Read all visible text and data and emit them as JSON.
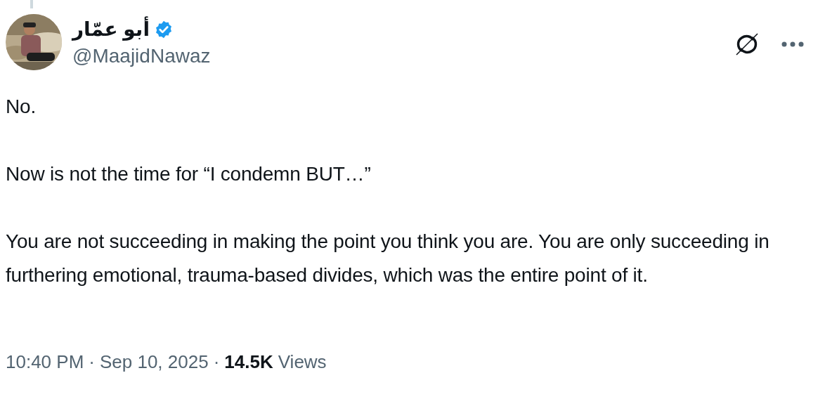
{
  "author": {
    "name": "أبو عمّار",
    "verified": true,
    "handle": "@MaajidNawaz"
  },
  "paragraphs": [
    "No.",
    "Now is not the time for “I condemn BUT…”",
    "You are not succeeding in making the point you think you are. You are only succeeding in furthering emotional, trauma-based divides, which was the entire point of it."
  ],
  "meta": {
    "time": "10:40 PM",
    "separator": "·",
    "date": "Sep 10, 2025",
    "separator_2": "·",
    "views_count": "14.5K",
    "views_label": "Views"
  }
}
